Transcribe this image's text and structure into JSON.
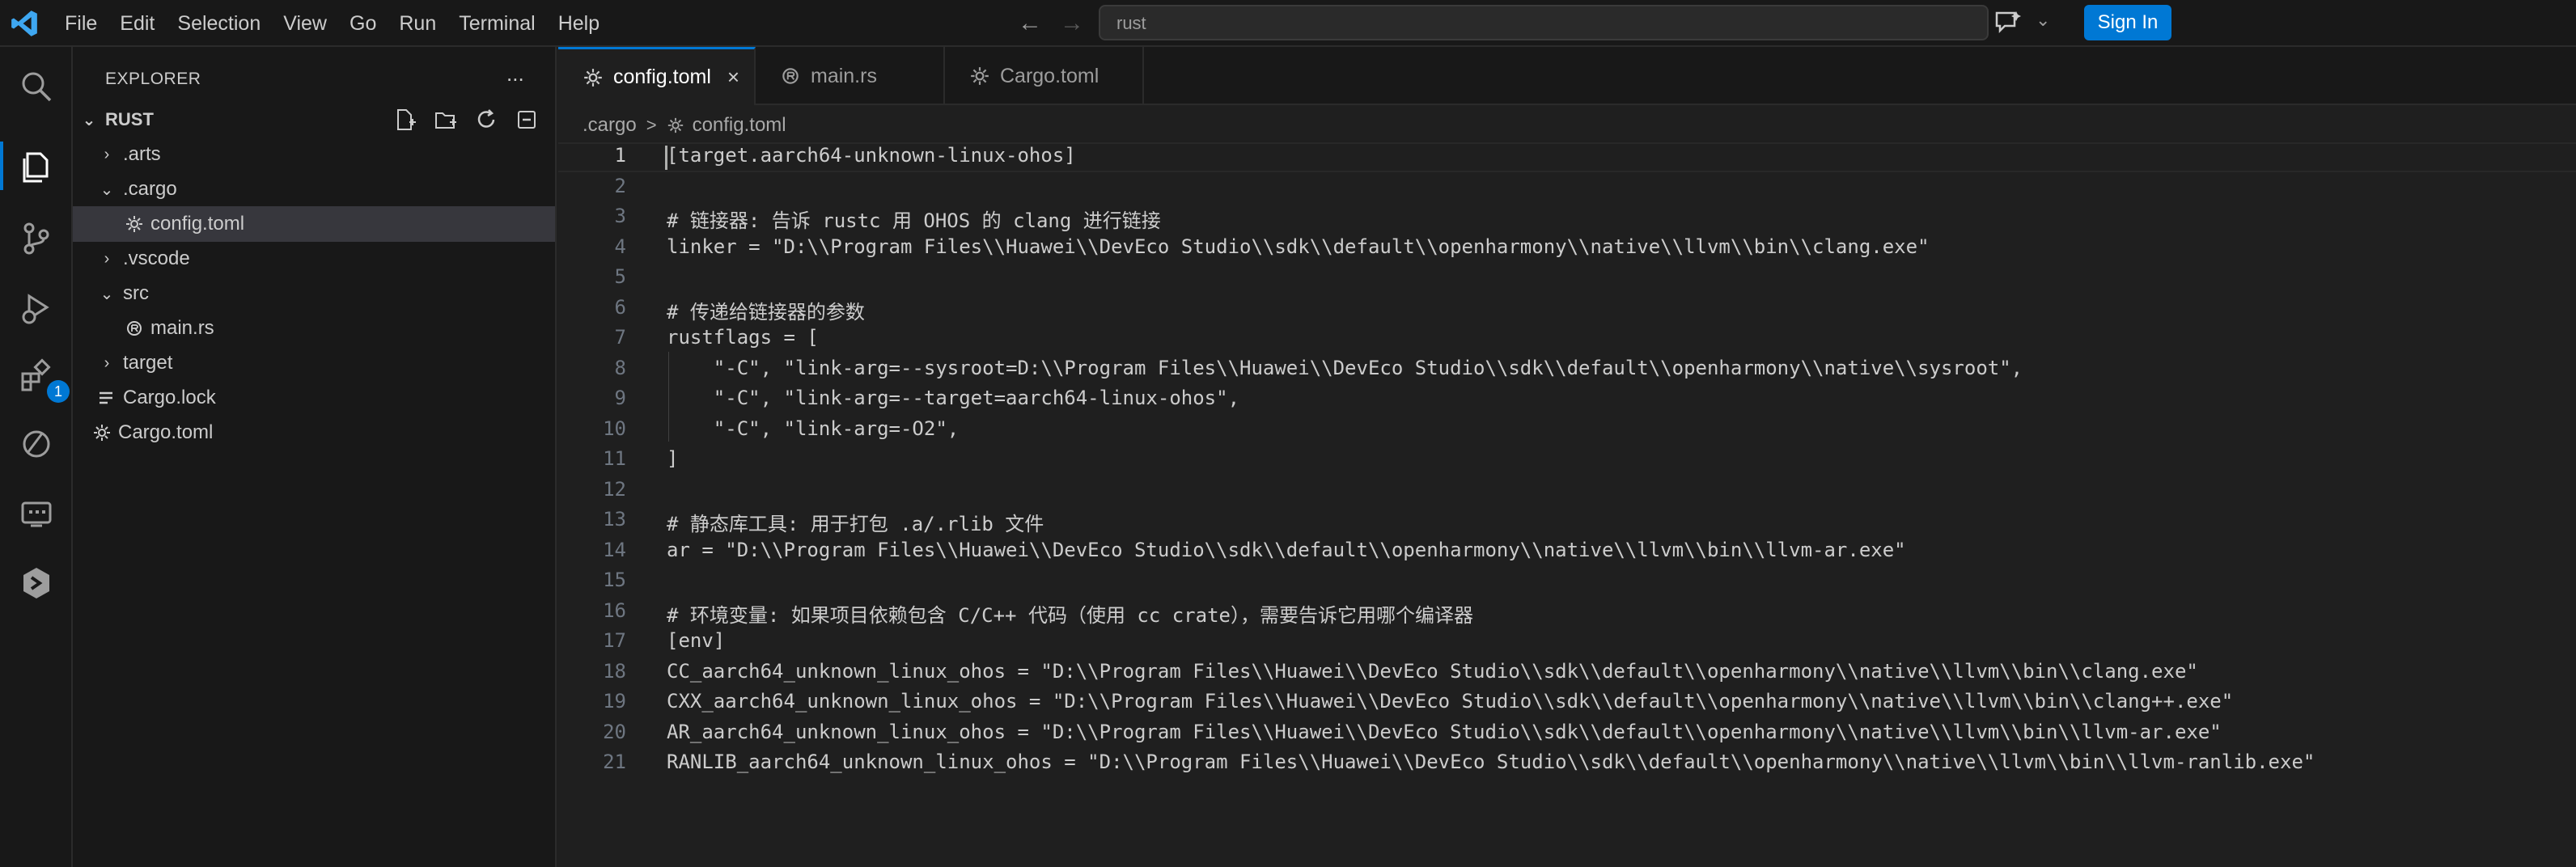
{
  "titlebar": {
    "menu": [
      "File",
      "Edit",
      "Selection",
      "View",
      "Go",
      "Run",
      "Terminal",
      "Help"
    ],
    "search_value": "rust",
    "signin_label": "Sign In"
  },
  "activity": {
    "extensions_badge": "1"
  },
  "explorer": {
    "title": "EXPLORER",
    "more": "...",
    "root": "RUST",
    "items": [
      {
        "label": ".arts",
        "type": "folder",
        "expanded": false
      },
      {
        "label": ".cargo",
        "type": "folder",
        "expanded": true
      },
      {
        "label": "config.toml",
        "type": "file",
        "selected": true
      },
      {
        "label": ".vscode",
        "type": "folder",
        "expanded": false
      },
      {
        "label": "src",
        "type": "folder",
        "expanded": true
      },
      {
        "label": "main.rs",
        "type": "file"
      },
      {
        "label": "target",
        "type": "folder",
        "expanded": false
      },
      {
        "label": "Cargo.lock",
        "type": "file"
      },
      {
        "label": "Cargo.toml",
        "type": "file"
      }
    ]
  },
  "tabs": [
    {
      "label": "config.toml",
      "active": true,
      "close": "×"
    },
    {
      "label": "main.rs",
      "active": false
    },
    {
      "label": "Cargo.toml",
      "active": false
    }
  ],
  "breadcrumb": {
    "folder": ".cargo",
    "sep": ">",
    "file": "config.toml"
  },
  "code": [
    {
      "n": "1",
      "text": "[target.aarch64-unknown-linux-ohos]"
    },
    {
      "n": "2",
      "text": ""
    },
    {
      "n": "3",
      "text": "# 链接器: 告诉 rustc 用 OHOS 的 clang 进行链接"
    },
    {
      "n": "4",
      "text": "linker = \"D:\\\\Program Files\\\\Huawei\\\\DevEco Studio\\\\sdk\\\\default\\\\openharmony\\\\native\\\\llvm\\\\bin\\\\clang.exe\""
    },
    {
      "n": "5",
      "text": ""
    },
    {
      "n": "6",
      "text": "# 传递给链接器的参数"
    },
    {
      "n": "7",
      "text": "rustflags = ["
    },
    {
      "n": "8",
      "text": "    \"-C\", \"link-arg=--sysroot=D:\\\\Program Files\\\\Huawei\\\\DevEco Studio\\\\sdk\\\\default\\\\openharmony\\\\native\\\\sysroot\","
    },
    {
      "n": "9",
      "text": "    \"-C\", \"link-arg=--target=aarch64-linux-ohos\","
    },
    {
      "n": "10",
      "text": "    \"-C\", \"link-arg=-O2\","
    },
    {
      "n": "11",
      "text": "]"
    },
    {
      "n": "12",
      "text": ""
    },
    {
      "n": "13",
      "text": "# 静态库工具: 用于打包 .a/.rlib 文件"
    },
    {
      "n": "14",
      "text": "ar = \"D:\\\\Program Files\\\\Huawei\\\\DevEco Studio\\\\sdk\\\\default\\\\openharmony\\\\native\\\\llvm\\\\bin\\\\llvm-ar.exe\""
    },
    {
      "n": "15",
      "text": ""
    },
    {
      "n": "16",
      "text": "# 环境变量: 如果项目依赖包含 C/C++ 代码（使用 cc crate），需要告诉它用哪个编译器"
    },
    {
      "n": "17",
      "text": "[env]"
    },
    {
      "n": "18",
      "text": "CC_aarch64_unknown_linux_ohos = \"D:\\\\Program Files\\\\Huawei\\\\DevEco Studio\\\\sdk\\\\default\\\\openharmony\\\\native\\\\llvm\\\\bin\\\\clang.exe\""
    },
    {
      "n": "19",
      "text": "CXX_aarch64_unknown_linux_ohos = \"D:\\\\Program Files\\\\Huawei\\\\DevEco Studio\\\\sdk\\\\default\\\\openharmony\\\\native\\\\llvm\\\\bin\\\\clang++.exe\""
    },
    {
      "n": "20",
      "text": "AR_aarch64_unknown_linux_ohos = \"D:\\\\Program Files\\\\Huawei\\\\DevEco Studio\\\\sdk\\\\default\\\\openharmony\\\\native\\\\llvm\\\\bin\\\\llvm-ar.exe\""
    },
    {
      "n": "21",
      "text": "RANLIB_aarch64_unknown_linux_ohos = \"D:\\\\Program Files\\\\Huawei\\\\DevEco Studio\\\\sdk\\\\default\\\\openharmony\\\\native\\\\llvm\\\\bin\\\\llvm-ranlib.exe\""
    }
  ],
  "colors": {
    "accent": "#0078d4",
    "editor_bg": "#1f1f1f",
    "sidebar_bg": "#181818",
    "logo": "#3ea7f1"
  }
}
